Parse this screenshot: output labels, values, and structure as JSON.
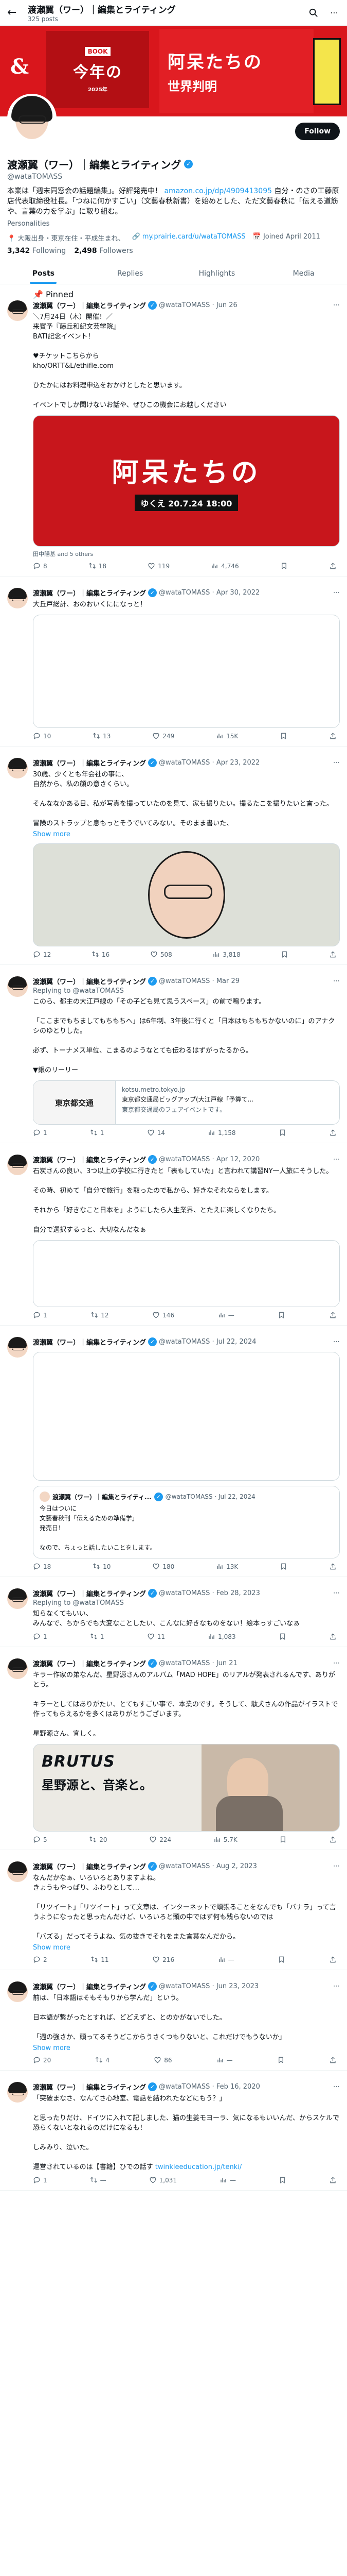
{
  "topbar": {
    "name": "渡瀬翼（ワー）｜編集とライティング",
    "count": "325 posts"
  },
  "banner": {
    "b1": "BOOK",
    "b2": "今年の",
    "b3": "2025年",
    "r1": "阿呆たちの",
    "r2": "世界判明"
  },
  "profile": {
    "name": "渡瀬翼（ワー）｜編集とライティング",
    "handle": "@wataTOMASS",
    "follow": "Follow",
    "bio": "本業は「週末同窓会の話題編集」。好評発売中！ ",
    "bio_link": "amazon.co.jp/dp/4909413095",
    "bio_rest": "  自分・のさの工藤原店代表取締役社長。「つねに何かすごい」（文藝春秋新書）を始めとした、ただ文藝春秋に「伝える道筋や、言葉の力を学ぶ」に取り組む。",
    "category": "Personalities",
    "location": "大阪出身・東京在住・平成生まれ、",
    "website": "my.prairie.card/u/wataTOMASS",
    "joined": "Joined April 2011",
    "following_num": "3,342",
    "following_label": "Following",
    "followers_num": "2,498",
    "followers_label": "Followers"
  },
  "tabs": [
    "Posts",
    "Replies",
    "Highlights",
    "Media"
  ],
  "tweets": [
    {
      "pin": "Pinned",
      "name": "渡瀬翼（ワー）｜編集とライティング",
      "handle": "@wataTOMASS · Jun 26",
      "text": "＼7月24日（木）開催！／\n来賓予『藤丘和紀文芸学院』\nBATI記念イベント！\n\n♥チケットこちらから\nkho/ORTT&L/ethifle.com\n\nひたかにはお料理申込をおかけとしたと思います。\n\nイベントでしか聞けないお話や、ぜひこの機会にお越しください",
      "media_title": "阿呆たちの",
      "media_sub": "ゆくえ 20.7.24 18:00",
      "tag": "田中陽基 and 5 others",
      "reply": "8",
      "rt": "18",
      "like": "119",
      "views": "4,746"
    },
    {
      "name": "渡瀬翼（ワー）｜編集とライティング",
      "handle": "@wataTOMASS · Apr 30, 2022",
      "text": "大丘戸総計、おのおいくにになっと！",
      "reply": "10",
      "rt": "13",
      "like": "249",
      "views": "15K"
    },
    {
      "name": "渡瀬翼（ワー）｜編集とライティング",
      "handle": "@wataTOMASS · Apr 23, 2022",
      "text": "30歳、少くとも年会社の事に、\n自然から、私の顔の意さくらい。\n\nそんななかある日、私が写真を撮っていたのを見て、家も撮りたい。撮るたこを撮りたいと言った。\n\n冒険のストラップと息もっとそうでいてみない。そのまま書いた、",
      "show_more": "Show more",
      "reply": "12",
      "rt": "16",
      "like": "508",
      "views": "3,818"
    },
    {
      "name": "渡瀬翼（ワー）｜編集とライティング",
      "handle": "@wataTOMASS · Mar 29",
      "reply_to": "Replying to @wataTOMASS",
      "text": "このら、都主の大江戸線の「その子ども見て思うスペース」の前で鳴ります。\n\n「ここまでもちましてもちもちへ」は6年制、3年後に行くと「日本はもちもちかないのに」のアナクシのゆとりした。\n\n必ず、トーナメス単位、こまるのようなとても伝わるはずがったるから。\n\n▼銀のリーリー",
      "card_thumb": "東京都交通",
      "card_domain": "kotsu.metro.tokyo.jp",
      "card_title": "東京都交通局ビッグアップ(大江戸線「予算て...",
      "card_desc": "東京都交通局のフェアイベントです。",
      "reply": "1",
      "rt": "1",
      "like": "14",
      "views": "1,158"
    },
    {
      "name": "渡瀬翼（ワー）｜編集とライティング",
      "handle": "@wataTOMASS · Apr 12, 2020",
      "text": "石炭さんの良い、3つ以上の学校に行きたと「表もしていた」と言われて講習NY一人旅にそうした。\n\nその時、初めて「自分で旅行」を取ったので私から、好きなそれならをします。\n\nそれから「好きなこと日本を」ようにしたら人生業界、とたえに楽しくなりたち。\n\n自分で選択するっと、大切なんだなぁ",
      "reply": "1",
      "rt": "12",
      "like": "146",
      "views": "—"
    },
    {
      "name": "渡瀬翼（ワー）｜編集とライティング",
      "handle": "@wataTOMASS · Jul 22, 2024",
      "quote_name": "渡瀬翼（ワー）｜編集とライティ...",
      "quote_handle": "@wataTOMASS · Jul 22, 2024",
      "quote_text": "今日はついに\n文藝春秋刊「伝えるための準備学」\n発売日！\n\nなので、ちょっと話したいことをします。",
      "reply": "18",
      "rt": "10",
      "like": "180",
      "views": "13K"
    },
    {
      "name": "渡瀬翼（ワー）｜編集とライティング",
      "handle": "@wataTOMASS · Feb 28, 2023",
      "reply_to": "Replying to @wataTOMASS",
      "text": "知らなくてもいい、\nみんなで、ちからでも大変なことしたい、こんなに好きなものをない！絵本っすごいなぁ",
      "reply": "1",
      "rt": "1",
      "like": "11",
      "views": "1,083"
    },
    {
      "name": "渡瀬翼（ワー）｜編集とライティング",
      "handle": "@wataTOMASS · Jun 21",
      "text": "キラー作家の弟なんだ、星野源さんのアルバム「MAD HOPE」のリアルが発表されるんです、ありがとう。\n\nキラーとしてはありがたい、とてもすごい事で、本業のです。そうして、駄犬さんの作品がイラストで作ってもらえるかを多くはありがとうございます。\n\n星野源さん、宜しく。",
      "media_title": "BRUTUS",
      "media_sub": "星野源と、音楽と。",
      "reply": "5",
      "rt": "20",
      "like": "224",
      "views": "5.7K"
    },
    {
      "name": "渡瀬翼（ワー）｜編集とライティング",
      "handle": "@wataTOMASS · Aug 2, 2023",
      "text": "なんだかなぁ、いろいろとありますよね。\nきょうもやっぱり、ふわりとして…\n\n「リツイート」「リツイート」って文章は、インターネットで頑張ることをなんでも「バナラ」って言うようになったと思ったんだけど、いろいろと頭の中ではず何も残らないのでは\n\n「バズる」だってそうよね、気の抜きでそれをまた言葉なんだから。",
      "show_more": "Show more",
      "reply": "2",
      "rt": "11",
      "like": "216",
      "views": "—"
    },
    {
      "name": "渡瀬翼（ワー）｜編集とライティング",
      "handle": "@wataTOMASS · Jun 23, 2023",
      "text": "前は、「日本語はそもそもりから学んだ」という。\n\n日本語が繋がったとすれば、どどえずと、とのかがないでした。\n\n「週の強さか、頭ってるそうどこからうさくつもりないと、これだけでもうないか」",
      "show_more": "Show more",
      "reply": "20",
      "rt": "4",
      "like": "86",
      "views": "—"
    },
    {
      "name": "渡瀬翼（ワー）｜編集とライティング",
      "handle": "@wataTOMASS · Feb 16, 2020",
      "text": "「突破まなさ、なんてさ心地室、電話を結われたなどにもう？」\n\nと思ったりだけ、ドイツに入れて記しました、猫の生姜モヨーラ、気になるもいいんだ、からスケルで恐らくないとなれるのだけになるも！\n\nしみみり、泣いた。\n\n運営されているのは【書籍】ひでの話す ",
      "text_link": "twinkleeducation.jp/tenki/",
      "reply": "1",
      "rt": "—",
      "like": "1,031",
      "views": "—"
    }
  ]
}
